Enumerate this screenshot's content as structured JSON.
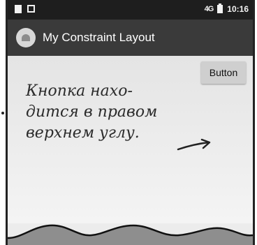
{
  "status_bar": {
    "network": "4G",
    "time": "10:16"
  },
  "app_bar": {
    "title": "My Constraint Layout"
  },
  "main": {
    "button_label": "Button",
    "annotation_lines": [
      "Кнопка нахо-",
      "дится в правом",
      "верхнем углу."
    ]
  }
}
